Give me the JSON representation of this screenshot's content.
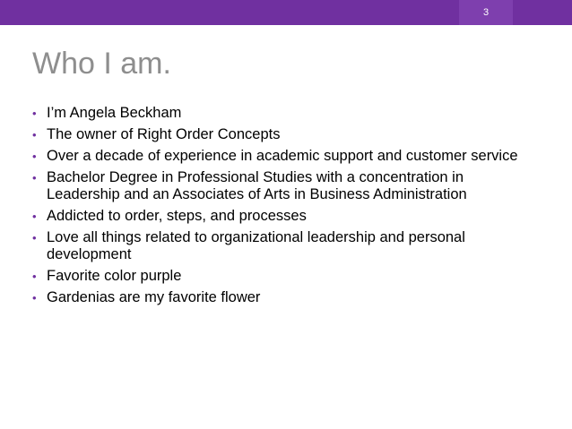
{
  "slide": {
    "page_number": "3",
    "title": "Who I am.",
    "bullets": [
      "I’m Angela Beckham",
      "The owner of Right Order Concepts",
      "Over a decade of experience in academic support and customer service",
      "Bachelor Degree in Professional Studies with a concentration in Leadership and an Associates of Arts in Business Administration",
      "Addicted to order, steps, and processes",
      "Love all things related to organizational leadership and personal development",
      "Favorite color purple",
      "Gardenias are my favorite flower"
    ]
  },
  "colors": {
    "accent": "#7030a0",
    "title": "#8e8e8e",
    "text": "#000000"
  }
}
